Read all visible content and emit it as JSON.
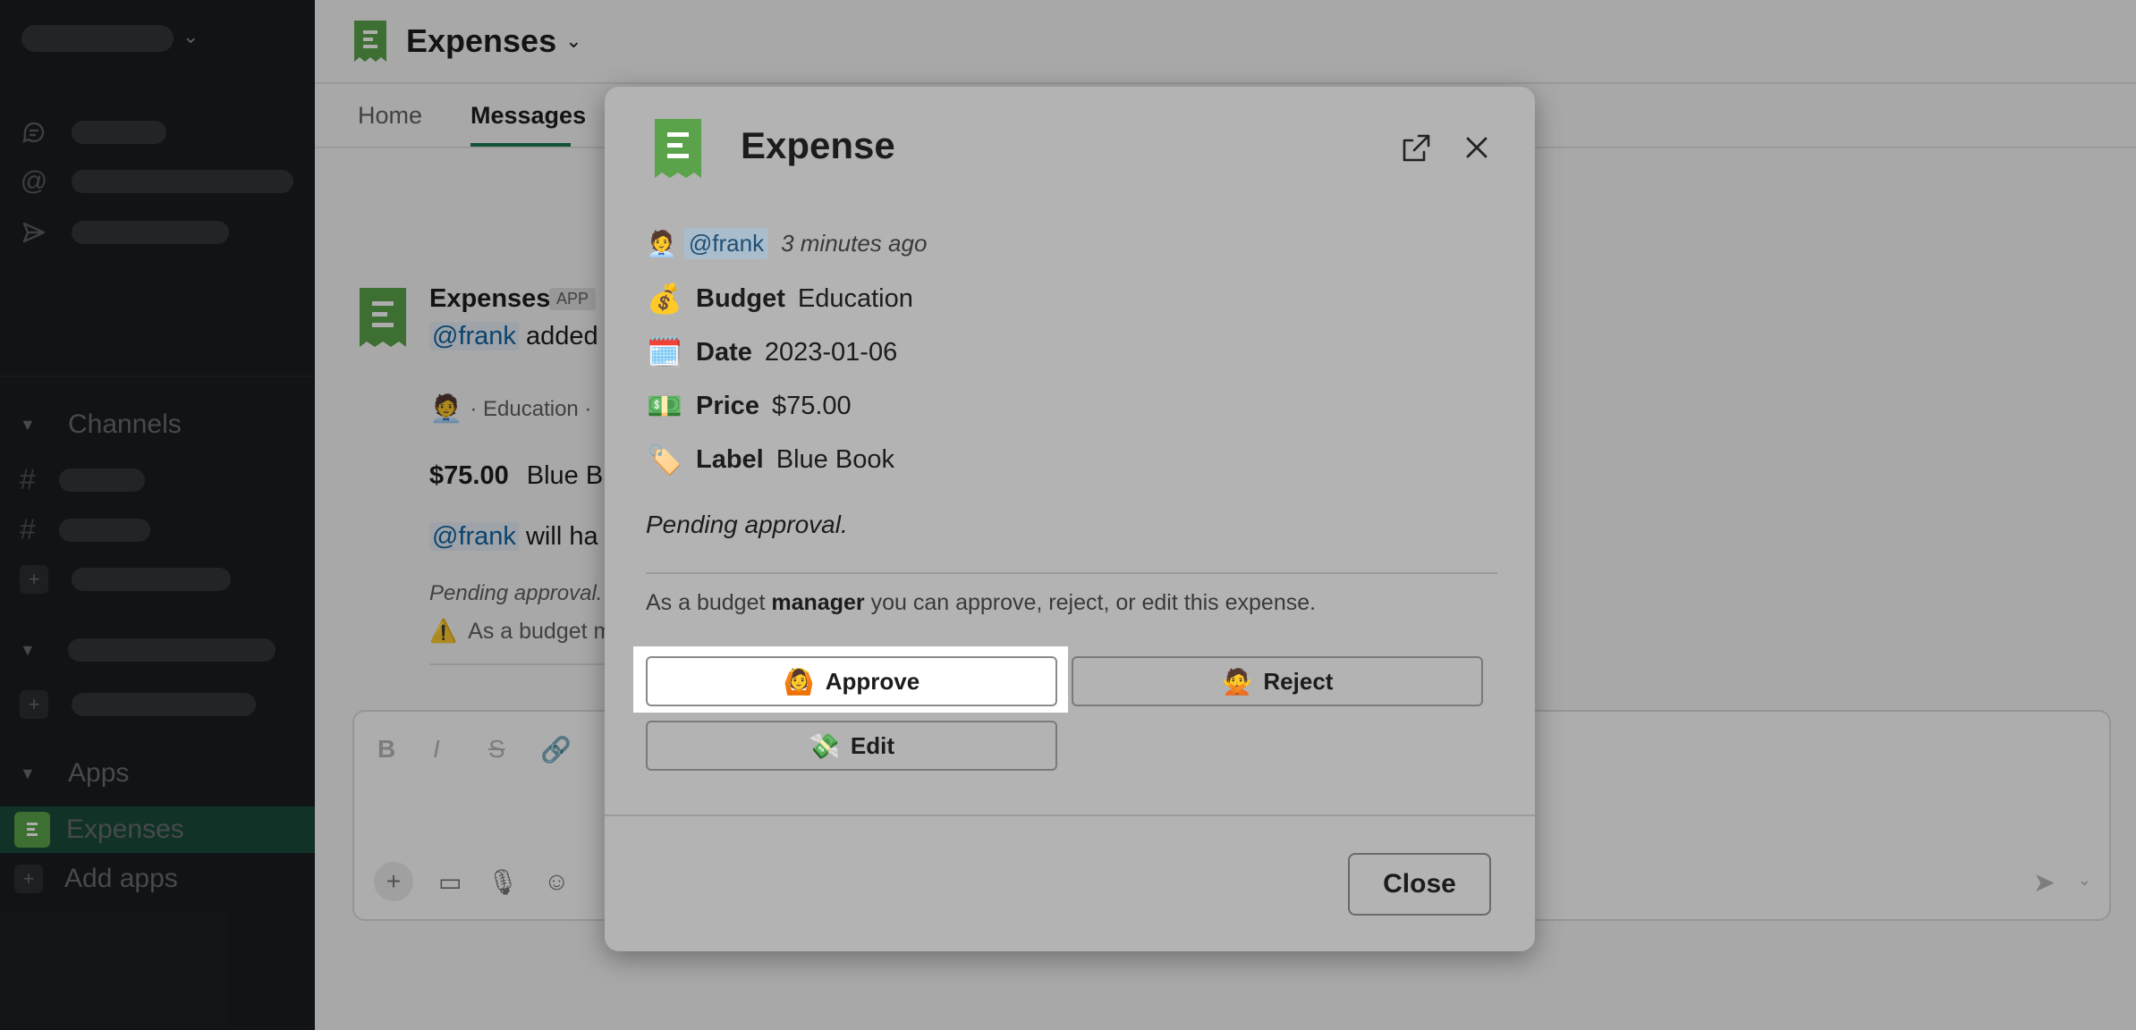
{
  "sidebar": {
    "sections": {
      "channels_label": "Channels",
      "apps_label": "Apps"
    },
    "apps": [
      {
        "label": "Expenses",
        "active": true
      },
      {
        "label": "Add apps",
        "active": false
      }
    ]
  },
  "header": {
    "title": "Expenses"
  },
  "tabs": [
    {
      "label": "Home"
    },
    {
      "label": "Messages"
    }
  ],
  "message": {
    "sender": "Expenses",
    "app_badge": "APP",
    "mention": "@frank",
    "line1_text": "added",
    "context": "· Education ·",
    "price": "$75.00",
    "label_partial": "Blue B",
    "line3_text": "will ha",
    "pending": "Pending approval.",
    "warning": "As a budget m"
  },
  "modal": {
    "title": "Expense",
    "user": "@frank",
    "time": "3 minutes ago",
    "fields": [
      {
        "icon": "money-bag-icon",
        "emoji": "💰",
        "label": "Budget",
        "value": "Education"
      },
      {
        "icon": "calendar-icon",
        "emoji": "🗓️",
        "label": "Date",
        "value": "2023-01-06"
      },
      {
        "icon": "dollar-bills-icon",
        "emoji": "💵",
        "label": "Price",
        "value": "$75.00"
      },
      {
        "icon": "label-tag-icon",
        "emoji": "🏷️",
        "label": "Label",
        "value": "Blue Book"
      }
    ],
    "status": "Pending approval.",
    "note_prefix": "As a budget",
    "note_bold": "manager",
    "note_suffix": "you can approve, reject, or edit this expense.",
    "buttons": {
      "approve": {
        "label": "Approve",
        "emoji": "🙆"
      },
      "reject": {
        "label": "Reject",
        "emoji": "🙅"
      },
      "edit": {
        "label": "Edit",
        "emoji": "💸"
      }
    },
    "close_label": "Close"
  },
  "colors": {
    "sidebar_bg": "#1a1d21",
    "active_app_bg": "#1a4a3a",
    "brand_green": "#5aa34a",
    "highlight": "#ffffff",
    "modal_bg": "#b3b3b3"
  }
}
